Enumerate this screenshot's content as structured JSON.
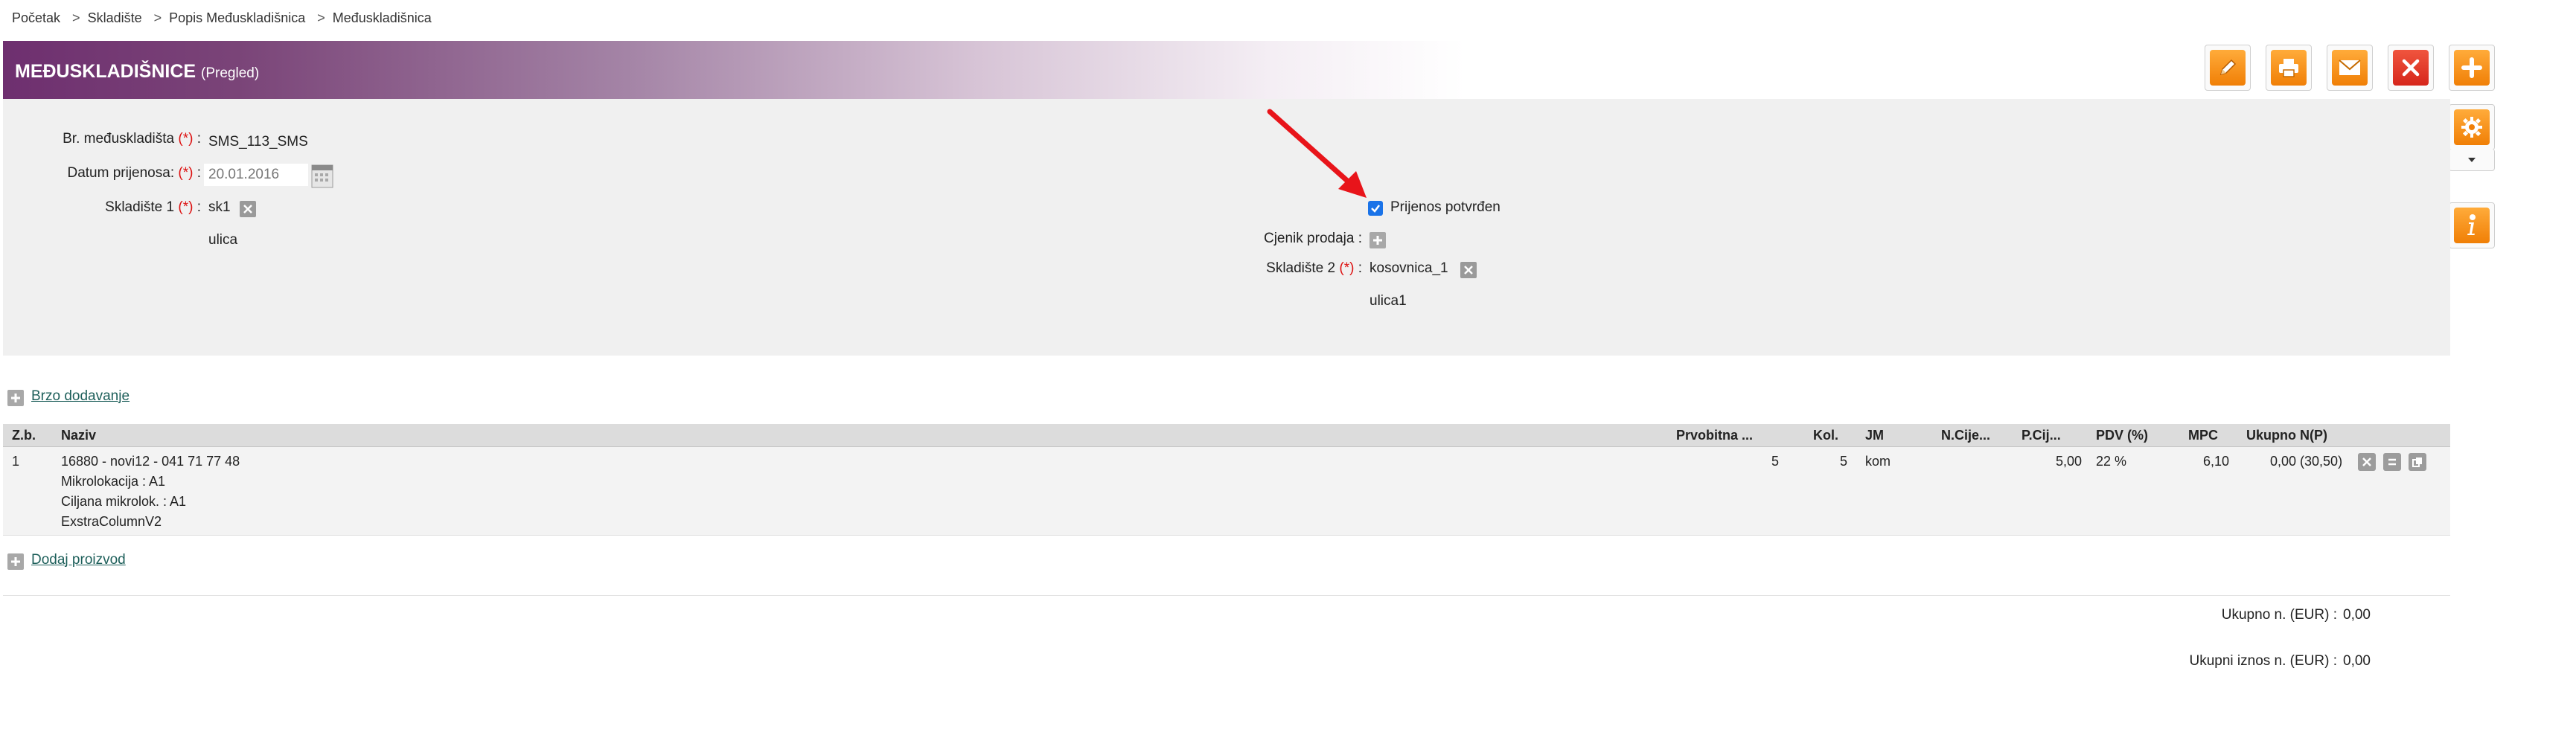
{
  "breadcrumb": {
    "items": [
      "Početak",
      "Skladište",
      "Popis Međuskladišnica",
      "Međuskladišnica"
    ],
    "separator": ">"
  },
  "header": {
    "title": "MEĐUSKLADIŠNICE",
    "subtitle": "(Pregled)"
  },
  "toolbar": {
    "buttons": [
      {
        "icon": "edit-icon",
        "color": "#f58a0b"
      },
      {
        "icon": "print-icon",
        "color": "#f58a0b"
      },
      {
        "icon": "email-icon",
        "color": "#f58a0b"
      },
      {
        "icon": "close-icon",
        "color": "#e03a2a"
      },
      {
        "icon": "add-icon",
        "color": "#f58a0b"
      }
    ],
    "side": [
      {
        "icon": "gear-icon"
      },
      {
        "icon": "dropdown-arrow-icon"
      },
      {
        "icon": "info-icon"
      }
    ]
  },
  "form": {
    "required_mark": "(*)",
    "br_label": "Br. međuskladišta",
    "br_value": "SMS_113_SMS",
    "datum_label": "Datum prijenosa:",
    "datum_value": "20.01.2016",
    "skl1_label": "Skladište 1",
    "skl1_value": "sk1",
    "skl1_address": "ulica",
    "prijenos_label": "Prijenos potvrđen",
    "prijenos_checked": true,
    "cjenik_label": "Cjenik prodaja :",
    "skl2_label": "Skladište 2",
    "skl2_value": "kosovnica_1",
    "skl2_address": "ulica1",
    "colon": ":"
  },
  "quick_add_label": "Brzo dodavanje",
  "table": {
    "headers": [
      "Z.b.",
      "Naziv",
      "Prvobitna ...",
      "Kol.",
      "JM",
      "N.Cije...",
      "P.Cij...",
      "PDV (%)",
      "MPC",
      "Ukupno N(P)"
    ],
    "rows": [
      {
        "zb": "1",
        "naziv": "16880 - novi12 - 041 71 77 48",
        "naziv_lines": [
          "Mikrolokacija : A1",
          "Ciljana mikrolok. : A1",
          "ExstraColumnV2"
        ],
        "prvobitna": "5",
        "kol": "5",
        "jm": "kom",
        "ncijena": "",
        "pcijena": "5,00",
        "pdv": "22 %",
        "mpc": "6,10",
        "ukupno": "0,00 (30,50)"
      }
    ]
  },
  "add_product_label": "Dodaj proizvod",
  "totals": {
    "ukupno_label": "Ukupno n. (EUR) :",
    "ukupno_value": "0,00",
    "iznos_label": "Ukupni iznos n. (EUR) :",
    "iznos_value": "0,00"
  },
  "colors": {
    "header_gradient_start": "#6e2f6f",
    "accent_orange": "#f58a0b",
    "accent_red": "#e03a2a",
    "required": "#dd1111",
    "link": "#1d5f5a",
    "arrow": "#e8141a"
  }
}
